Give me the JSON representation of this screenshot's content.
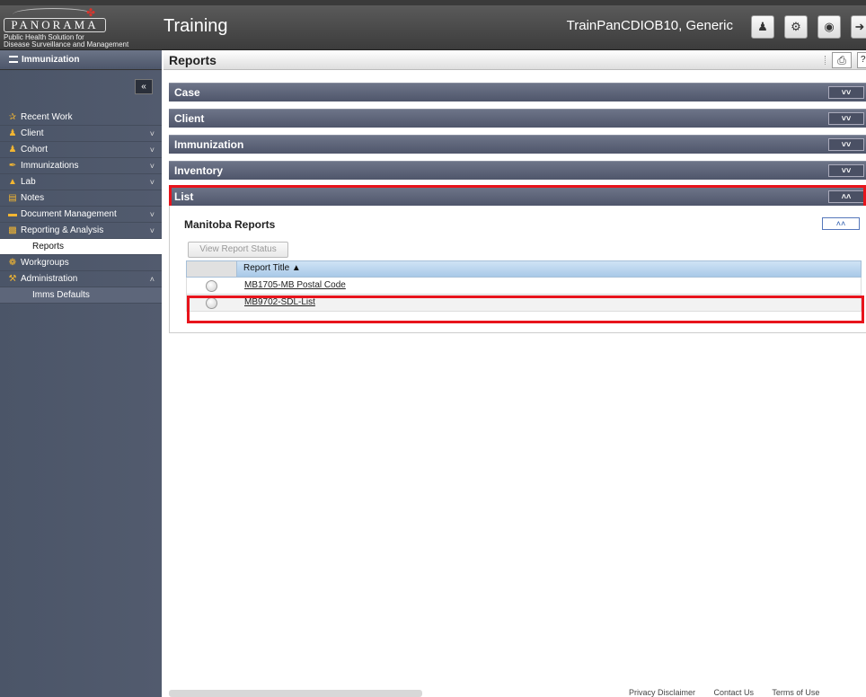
{
  "header": {
    "logo": {
      "name": "PANORAMA",
      "subtitle_line1": "Public Health Solution for",
      "subtitle_line2": "Disease Surveillance and Management"
    },
    "app_title": "Training",
    "user_name": "TrainPanCDIOB10, Generic",
    "icons": [
      "user-icon",
      "gear-icon",
      "globe-icon",
      "logout-icon"
    ]
  },
  "sidebar": {
    "header_label": "Immunization",
    "collapse_label": "«",
    "items": [
      {
        "label": "Recent Work",
        "icon": "star-icon",
        "chevron": ""
      },
      {
        "label": "Client",
        "icon": "person-icon",
        "chevron": "˅"
      },
      {
        "label": "Cohort",
        "icon": "group-icon",
        "chevron": "˅"
      },
      {
        "label": "Immunizations",
        "icon": "syringe-icon",
        "chevron": "˅"
      },
      {
        "label": "Lab",
        "icon": "flask-icon",
        "chevron": "˅"
      },
      {
        "label": "Notes",
        "icon": "note-icon",
        "chevron": ""
      },
      {
        "label": "Document Management",
        "icon": "folder-icon",
        "chevron": "˅"
      },
      {
        "label": "Reporting & Analysis",
        "icon": "chart-icon",
        "chevron": "˅"
      },
      {
        "label": "Reports",
        "icon": "",
        "chevron": ""
      },
      {
        "label": "Workgroups",
        "icon": "workgroup-icon",
        "chevron": ""
      },
      {
        "label": "Administration",
        "icon": "wrench-icon",
        "chevron": "˄"
      },
      {
        "label": "Imms Defaults",
        "icon": "",
        "chevron": ""
      }
    ]
  },
  "main": {
    "title": "Reports",
    "sections": [
      {
        "label": "Case",
        "toggle": "˅˅"
      },
      {
        "label": "Client",
        "toggle": "˅˅"
      },
      {
        "label": "Immunization",
        "toggle": "˅˅"
      },
      {
        "label": "Inventory",
        "toggle": "˅˅"
      },
      {
        "label": "List",
        "toggle": "˄˄"
      }
    ],
    "list_panel": {
      "title": "Manitoba Reports",
      "collapse_toggle": "˄˄",
      "view_status_label": "View Report Status",
      "columns": [
        "Report Title ▲"
      ],
      "rows": [
        {
          "title": "MB1705-MB Postal Code"
        },
        {
          "title": "MB9702-SDL-List"
        }
      ]
    }
  },
  "footer": {
    "links": [
      "Privacy Disclaimer",
      "Contact Us",
      "Terms of Use"
    ]
  },
  "colors": {
    "highlight_red": "#e8141c",
    "section_bar": "#5a6176",
    "sidebar_bg": "#4e576b",
    "grid_header": "#b9d4ee"
  }
}
